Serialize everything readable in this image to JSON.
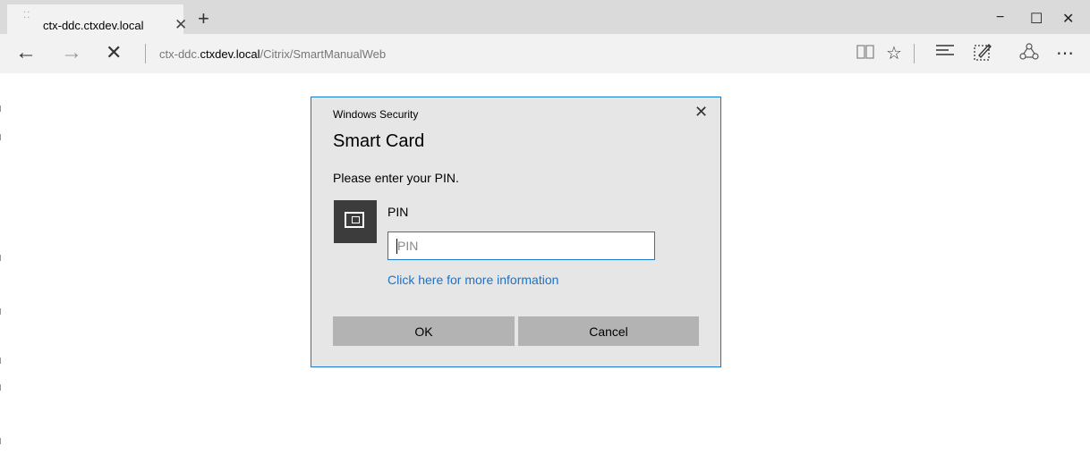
{
  "browser": {
    "tab": {
      "title": "ctx-ddc.ctxdev.local",
      "loading_glyph": "⁚⁚"
    },
    "new_tab_glyph": "+",
    "tab_close_glyph": "✕",
    "window_controls": {
      "minimize": "−",
      "maximize": "☐",
      "close": "✕"
    },
    "nav": {
      "back": "←",
      "forward": "→",
      "stop": "✕"
    },
    "address": {
      "prefix": "ctx-ddc.",
      "host": "ctxdev.local",
      "path": "/Citrix/SmartManualWeb"
    },
    "toolbar_icons": [
      "reading-view-icon",
      "favorites-star-icon",
      "hub-icon",
      "web-note-icon",
      "share-icon",
      "more-icon"
    ],
    "toolbar_glyphs": {
      "reading": "📖",
      "star": "☆",
      "hub": "☰",
      "note": "✎",
      "share": "⟡",
      "more": "⋯"
    }
  },
  "dialog": {
    "caption": "Windows Security",
    "close_glyph": "✕",
    "heading": "Smart Card",
    "prompt": "Please enter your PIN.",
    "pin_label": "PIN",
    "pin_placeholder": "PIN",
    "pin_value": "",
    "more_info_link": "Click here for more information",
    "ok_label": "OK",
    "cancel_label": "Cancel"
  },
  "colors": {
    "accent": "#1979ca",
    "link": "#1a73c7",
    "dialog_bg": "#e6e6e6",
    "button_bg": "#b3b3b3"
  }
}
